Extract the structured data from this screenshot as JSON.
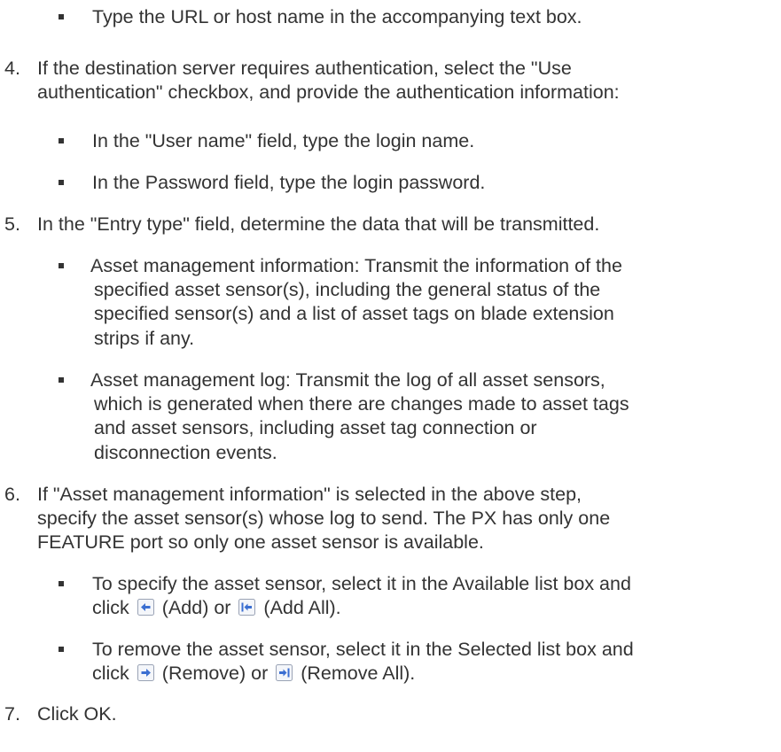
{
  "items": {
    "url_bullet": "Type the URL or host name in the accompanying text box.",
    "step4": {
      "number": "4.",
      "line1": "If the destination server requires authentication, select the \"Use",
      "line2": "authentication\" checkbox, and provide the authentication information:",
      "bullet1": "In the \"User name\" field, type the login name.",
      "bullet2": "In the Password field, type the login password."
    },
    "step5": {
      "number": "5.",
      "line1": "In the \"Entry type\" field, determine the data that will be transmitted.",
      "bullet1_lines": [
        "Asset management information: Transmit the information of the",
        "specified asset sensor(s), including the general status of the",
        "specified sensor(s) and a list of asset tags on blade extension",
        "strips if any."
      ],
      "bullet2_lines": [
        "Asset management log: Transmit the log of all asset sensors,",
        "which is generated when there are changes made to asset tags",
        "and asset sensors, including asset tag connection or",
        "disconnection events."
      ]
    },
    "step6": {
      "number": "6.",
      "lines": [
        "If \"Asset management information\" is selected in the above step,",
        "specify the asset sensor(s) whose log to send. The PX has only one",
        "FEATURE port so only one asset sensor is available."
      ],
      "bullet1_line1": "To specify the asset sensor, select it in the Available list box and",
      "bullet1_click": "click",
      "bullet1_add": "(Add) or",
      "bullet1_addall": "(Add All).",
      "bullet2_line1": "To remove the asset sensor, select it in the Selected list box and",
      "bullet2_click": "click",
      "bullet2_remove": "(Remove) or",
      "bullet2_removeall": "(Remove All)."
    },
    "step7": {
      "number": "7.",
      "text": "Click OK."
    }
  },
  "icons": {
    "add": "arrow-left-icon",
    "add_all": "arrow-left-bar-icon",
    "remove": "arrow-right-icon",
    "remove_all": "arrow-right-bar-icon"
  },
  "colors": {
    "text": "#333333",
    "icon_border": "#9aa3b5",
    "icon_arrow": "#3b6fd1"
  }
}
